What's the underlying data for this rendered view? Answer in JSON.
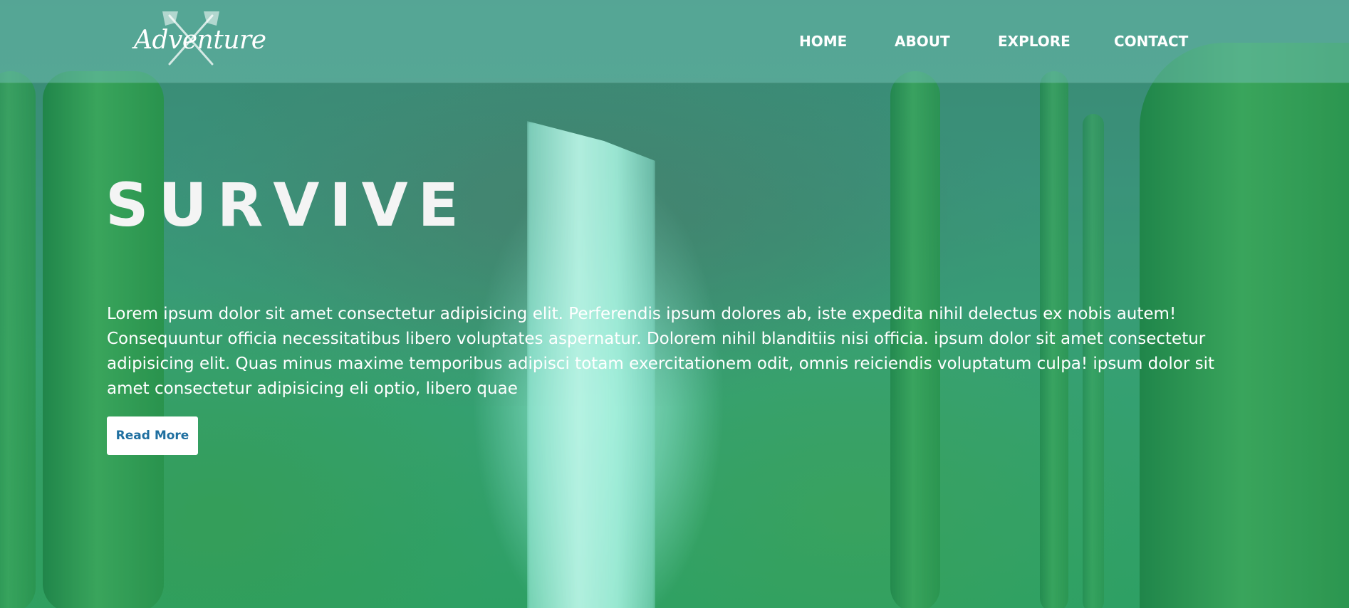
{
  "brand": {
    "logo_text": "Adventure",
    "logo_icon": "crossed-axes-icon"
  },
  "nav": {
    "items": [
      {
        "label": "HOME"
      },
      {
        "label": "ABOUT"
      },
      {
        "label": "EXPLORE"
      },
      {
        "label": "CONTACT"
      }
    ]
  },
  "hero": {
    "title": "SURVIVE",
    "body": "Lorem ipsum dolor sit amet consectetur adipisicing elit. Perferendis ipsum dolores ab, iste expedita nihil delectus ex nobis autem! Consequuntur officia necessitatibus libero voluptates aspernatur. Dolorem nihil blanditiis nisi officia. ipsum dolor sit amet consectetur adipisicing elit. Quas minus maxime temporibus adipisci totam exercitationem odit, omnis reiciendis voluptatum culpa! ipsum dolor sit amet consectetur adipisicing eli optio, libero quae",
    "cta_label": "Read More",
    "background": "forest-waterfall-image"
  },
  "colors": {
    "overlay": "#2fb894",
    "cta_text": "#1f6fa0",
    "header_bg": "#6ebeaf"
  }
}
